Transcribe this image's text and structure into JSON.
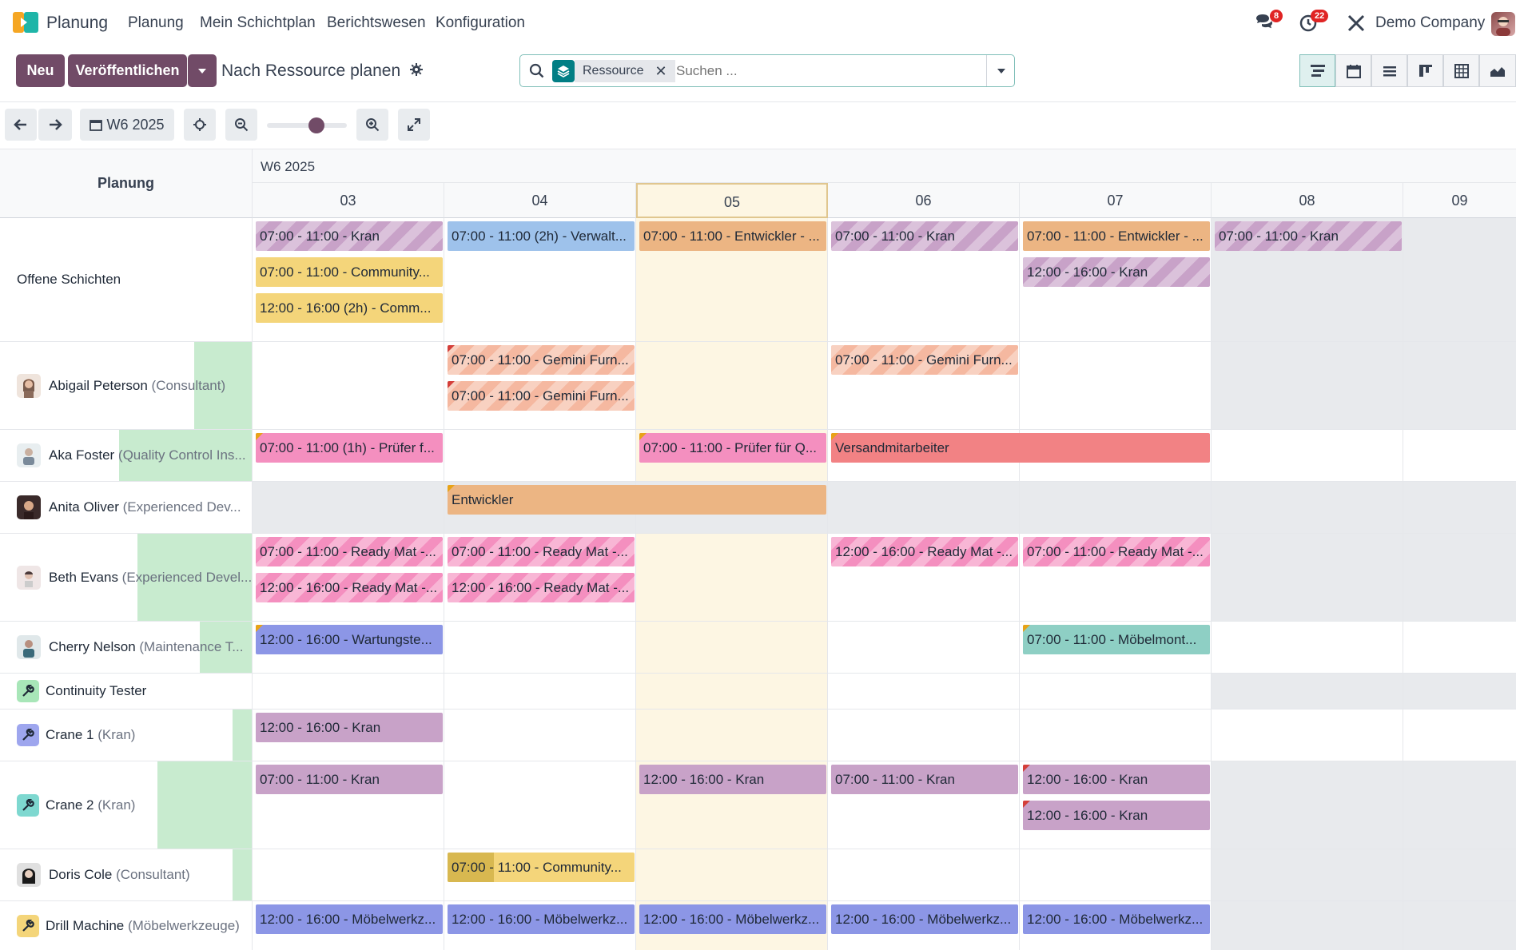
{
  "navbar": {
    "brand": "Planung",
    "menu": [
      "Planung",
      "Mein Schichtplan",
      "Berichtswesen",
      "Konfiguration"
    ],
    "messages_count": "8",
    "activities_count": "22",
    "company": "Demo Company"
  },
  "control": {
    "new_label": "Neu",
    "publish_label": "Veröffentlichen",
    "title": "Nach Ressource planen",
    "facet_label": "Ressource",
    "search_placeholder": "Suchen ..."
  },
  "toolbar": {
    "week_label": "W6 2025"
  },
  "gantt": {
    "left_header": "Planung",
    "week_header": "W6 2025",
    "days": [
      "03",
      "04",
      "05",
      "06",
      "07",
      "08",
      "09"
    ],
    "today_index": 2,
    "rows": [
      {
        "name": "Offene Schichten",
        "job": ""
      },
      {
        "name": "Abigail Peterson",
        "job": " (Consultant)"
      },
      {
        "name": "Aka Foster",
        "job": " (Quality Control Ins..."
      },
      {
        "name": "Anita Oliver",
        "job": " (Experienced Dev..."
      },
      {
        "name": "Beth Evans",
        "job": " (Experienced Devel..."
      },
      {
        "name": "Cherry Nelson",
        "job": " (Maintenance T..."
      },
      {
        "name": "Continuity Tester",
        "job": ""
      },
      {
        "name": "Crane 1",
        "job": " (Kran)"
      },
      {
        "name": "Crane 2",
        "job": " (Kran)"
      },
      {
        "name": "Doris Cole",
        "job": " (Consultant)"
      },
      {
        "name": "Drill Machine",
        "job": " (Möbelwerkzeuge)"
      }
    ],
    "pills": [
      "07:00 - 11:00 - Kran",
      "07:00 - 11:00 - Community...",
      "12:00 - 16:00 (2h) - Comm...",
      "07:00 - 11:00 (2h) - Verwalt...",
      "07:00 - 11:00 - Entwickler - ...",
      "07:00 - 11:00 - Kran",
      "07:00 - 11:00 - Entwickler - ...",
      "12:00 - 16:00 - Kran",
      "07:00 - 11:00 - Kran",
      "07:00 - 11:00 - Gemini Furn...",
      "07:00 - 11:00 - Gemini Furn...",
      "07:00 - 11:00 - Gemini Furn...",
      "07:00 - 11:00 (1h) - Prüfer f...",
      "07:00 - 11:00 - Prüfer für Q...",
      "Versandmitarbeiter",
      "Entwickler",
      "07:00 - 11:00 - Ready Mat -...",
      "12:00 - 16:00 - Ready Mat -...",
      "07:00 - 11:00 - Ready Mat -...",
      "12:00 - 16:00 - Ready Mat -...",
      "12:00 - 16:00 - Ready Mat -...",
      "07:00 - 11:00 - Ready Mat -...",
      "12:00 - 16:00 - Wartungste...",
      "07:00 - 11:00 - Möbelmont...",
      "12:00 - 16:00 - Kran",
      "07:00 - 11:00 - Kran",
      "12:00 - 16:00 - Kran",
      "07:00 - 11:00 - Kran",
      "12:00 - 16:00 - Kran",
      "12:00 - 16:00 - Kran",
      "07:00 - 11:00 - Community...",
      "12:00 - 16:00 - Möbelwerkz...",
      "12:00 - 16:00 - Möbelwerkz...",
      "12:00 - 16:00 - Möbelwerkz...",
      "12:00 - 16:00 - Möbelwerkz...",
      "12:00 - 16:00 - Möbelwerkz..."
    ]
  },
  "colors": {
    "brand": "#714b67",
    "today": "#fdf6e3",
    "capacity": "#c8ebcf"
  }
}
